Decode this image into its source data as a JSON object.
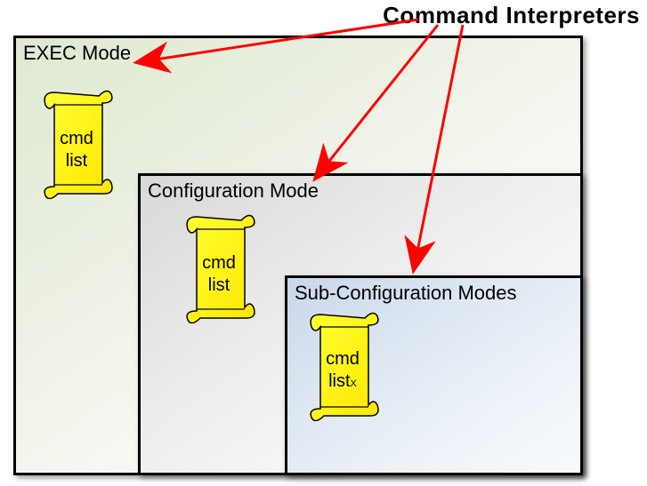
{
  "title": "Command Interpreters",
  "boxes": {
    "exec": {
      "label": "EXEC Mode"
    },
    "config": {
      "label": "Configuration Mode"
    },
    "sub": {
      "label": "Sub-Configuration Modes"
    }
  },
  "scrolls": {
    "exec": {
      "line1": "cmd",
      "line2": "list",
      "subscript": ""
    },
    "config": {
      "line1": "cmd",
      "line2": "list",
      "subscript": ""
    },
    "sub": {
      "line1": "cmd",
      "line2": "list",
      "subscript": "X"
    }
  },
  "arrows": {
    "color": "#ff0000",
    "targets": [
      "exec-mode",
      "configuration-mode",
      "sub-configuration-modes"
    ]
  }
}
